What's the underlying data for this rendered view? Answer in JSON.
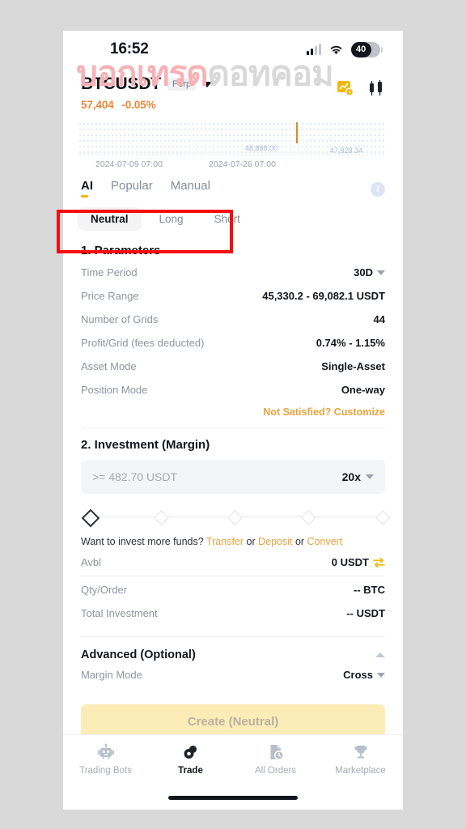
{
  "status_bar": {
    "time": "16:52",
    "battery_level": "40",
    "signal_icon": "signal-bars-icon",
    "wifi_icon": "wifi-icon"
  },
  "watermark": {
    "part_pink": "บอกเทรด",
    "part_gray": "ดอทคอม"
  },
  "symbol_header": {
    "name": "BTCUSDT",
    "badge": "Perp",
    "price": "57,404",
    "change": "-0.05%",
    "change_color": "#e8873a",
    "chart_icon": "line-chart-icon",
    "candles_icon": "candlestick-icon"
  },
  "chart": {
    "axis_labels": [
      "2024-07-09 07:00",
      "2024-07-26 07:00"
    ],
    "price_markers": [
      "48,888.00",
      "47,828.34"
    ]
  },
  "chart_data": {
    "type": "line",
    "title": "",
    "x": [
      "2024-07-09 07:00",
      "2024-07-26 07:00"
    ],
    "annotations": [
      "48,888.00",
      "47,828.34"
    ],
    "grid": true,
    "gridline_color": "#bfd4ea",
    "marker_color": "#e8873a",
    "xlabel": "",
    "ylabel": ""
  },
  "strategy_tabs": {
    "items": [
      {
        "label": "AI",
        "active": true
      },
      {
        "label": "Popular",
        "active": false
      },
      {
        "label": "Manual",
        "active": false
      }
    ],
    "info_icon": "info-icon"
  },
  "direction": {
    "options": [
      {
        "label": "Neutral",
        "active": true
      },
      {
        "label": "Long",
        "active": false
      },
      {
        "label": "Short",
        "active": false
      }
    ]
  },
  "parameters": {
    "title": "1. Parameters",
    "rows": [
      {
        "label": "Time Period",
        "value": "30D",
        "caret": true
      },
      {
        "label": "Price Range",
        "value": "45,330.2 - 69,082.1 USDT",
        "caret": false
      },
      {
        "label": "Number of Grids",
        "value": "44",
        "caret": false
      },
      {
        "label": "Profit/Grid (fees deducted)",
        "value": "0.74% - 1.15%",
        "caret": false
      },
      {
        "label": "Asset Mode",
        "value": "Single-Asset",
        "caret": false
      },
      {
        "label": "Position Mode",
        "value": "One-way",
        "caret": false
      }
    ],
    "customize_link": "Not Satisfied? Customize"
  },
  "investment": {
    "title": "2. Investment (Margin)",
    "input_placeholder": ">= 482.70 USDT",
    "input_value": "",
    "leverage": "20x",
    "slider_marks": 5,
    "slider_position": 0,
    "funds_prefix": "Want to invest more funds? ",
    "funds_links": [
      "Transfer",
      "Deposit",
      "Convert"
    ],
    "funds_sep": " or ",
    "link_color": "#e8a33d",
    "rows": [
      {
        "label": "Avbl",
        "value": "0 USDT",
        "icon": "transfer-arrows-icon"
      },
      {
        "label": "Qty/Order",
        "value": "-- BTC",
        "icon": ""
      },
      {
        "label": "Total Investment",
        "value": "-- USDT",
        "icon": ""
      }
    ]
  },
  "advanced": {
    "title": "Advanced (Optional)",
    "collapse_icon": "chevron-up-icon",
    "rows": [
      {
        "label": "Margin Mode",
        "value": "Cross",
        "caret": true
      }
    ]
  },
  "create_button": {
    "label": "Create (Neutral)",
    "background": "#fcecb8",
    "text_color": "#b9b2a0"
  },
  "bottom_nav": {
    "items": [
      {
        "label": "Trading Bots",
        "icon": "robot-icon",
        "active": false
      },
      {
        "label": "Trade",
        "icon": "trade-coins-icon",
        "active": true
      },
      {
        "label": "All Orders",
        "icon": "orders-clock-icon",
        "active": false
      },
      {
        "label": "Marketplace",
        "icon": "trophy-icon",
        "active": false
      }
    ]
  },
  "annotation": {
    "color": "#f50d0d",
    "target": "direction-selector"
  }
}
